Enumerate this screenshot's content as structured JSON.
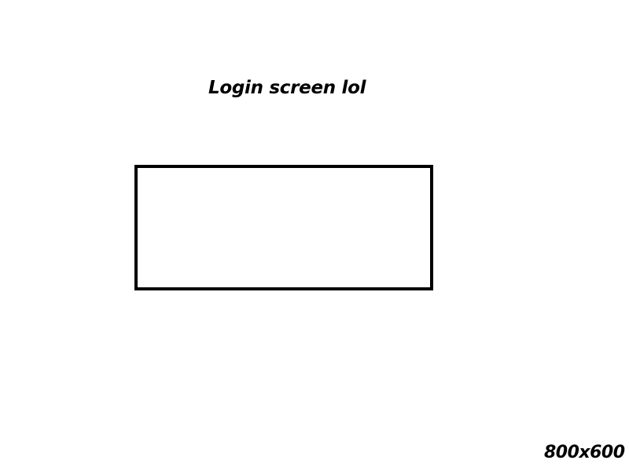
{
  "page": {
    "title": "Login screen lol",
    "size_label": "800x600"
  },
  "colors": {
    "background": "#ffffff",
    "ink": "#000000"
  }
}
